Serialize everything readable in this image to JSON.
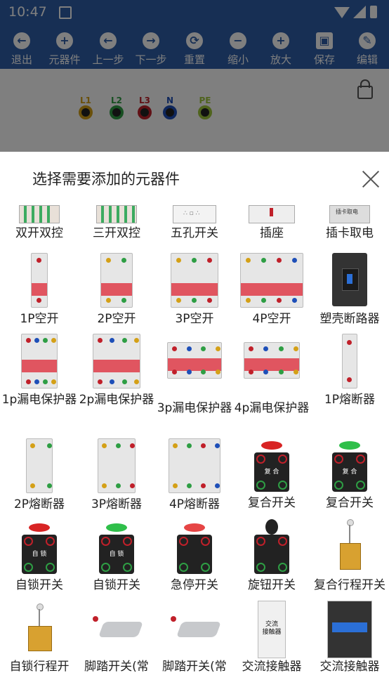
{
  "status": {
    "time": "10:47"
  },
  "toolbar": {
    "items": [
      {
        "label": "退出",
        "icon": "back-arrow-icon",
        "glyph": "←"
      },
      {
        "label": "元器件",
        "icon": "add-circle-icon",
        "glyph": "+"
      },
      {
        "label": "上一步",
        "icon": "left-arrow-icon",
        "glyph": "←"
      },
      {
        "label": "下一步",
        "icon": "right-arrow-icon",
        "glyph": "→"
      },
      {
        "label": "重置",
        "icon": "reset-icon",
        "glyph": "⟳"
      },
      {
        "label": "缩小",
        "icon": "zoom-out-icon",
        "glyph": "−"
      },
      {
        "label": "放大",
        "icon": "zoom-in-icon",
        "glyph": "+"
      },
      {
        "label": "保存",
        "icon": "save-icon",
        "glyph": "▣"
      },
      {
        "label": "编辑",
        "icon": "edit-icon",
        "glyph": "✎"
      }
    ]
  },
  "canvas": {
    "terminals": [
      {
        "label": "L1",
        "color": "#d4a017"
      },
      {
        "label": "L2",
        "color": "#2e9e44"
      },
      {
        "label": "L3",
        "color": "#c0202a"
      },
      {
        "label": "N",
        "color": "#1e4fb8"
      },
      {
        "label": "PE",
        "color": "#9ec63a"
      }
    ]
  },
  "sheet": {
    "title": "选择需要添加的元器件",
    "rows": [
      [
        "双开双控",
        "三开双控",
        "五孔开关",
        "插座",
        "插卡取电"
      ],
      [
        "1P空开",
        "2P空开",
        "3P空开",
        "4P空开",
        "塑壳断路器"
      ],
      [
        "1p漏电保护器",
        "2p漏电保护器",
        "3p漏电保护器",
        "4p漏电保护器",
        "1P熔断器"
      ],
      [
        "2P熔断器",
        "3P熔断器",
        "4P熔断器",
        "复合开关",
        "复合开关"
      ],
      [
        "自锁开关",
        "自锁开关",
        "急停开关",
        "旋钮开关",
        "复合行程开关"
      ],
      [
        "自锁行程开",
        "脚踏开关(常",
        "脚踏开关(常",
        "交流接触器",
        "交流接触器"
      ]
    ],
    "row5_extra": {
      "cont1_text": "交流\n接触器"
    },
    "labels_on_parts": {
      "button_text": "复 合",
      "self_lock_text": "自 锁",
      "card_text": "插卡取电"
    }
  }
}
